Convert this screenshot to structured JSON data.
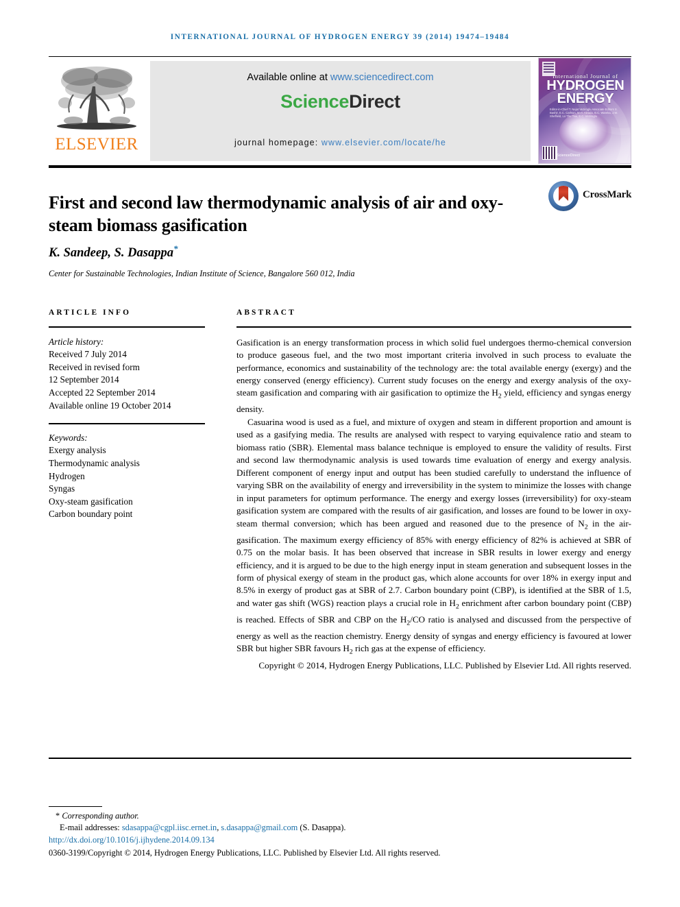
{
  "running_head": "International Journal of Hydrogen Energy 39 (2014) 19474–19484",
  "masthead": {
    "publisher_name": "ELSEVIER",
    "available_prefix": "Available online at ",
    "available_url": "www.sciencedirect.com",
    "sciencedirect_logo_part1": "Science",
    "sciencedirect_logo_part2": "Direct",
    "homepage_label": "journal homepage: ",
    "homepage_url": "www.elsevier.com/locate/he",
    "cover": {
      "line_small": "International Journal of",
      "line_big_1": "HYDROGEN",
      "line_big_2": "ENERGY",
      "editorial_board": "Editor-in-Chief  T. Nejat Veziroglu\nAssociate Editors  S. Bashir, E.C. Carlson, M.H. Aleada, B.C. Wareka, J.W. Sheffield, Lo Thu Tsai, E.C. Veziroglu",
      "footer_label": "ScienceDirect"
    }
  },
  "article": {
    "title": "First and second law thermodynamic analysis of air and oxy-steam biomass gasification",
    "crossmark_label": "CrossMark",
    "authors": "K. Sandeep, S. Dasappa",
    "author_star": "*",
    "affiliation": "Center for Sustainable Technologies, Indian Institute of Science, Bangalore 560 012, India"
  },
  "article_info": {
    "heading": "ARTICLE INFO",
    "history_label": "Article history:",
    "history": [
      "Received 7 July 2014",
      "Received in revised form",
      "12 September 2014",
      "Accepted 22 September 2014",
      "Available online 19 October 2014"
    ],
    "keywords_label": "Keywords:",
    "keywords": [
      "Exergy analysis",
      "Thermodynamic analysis",
      "Hydrogen",
      "Syngas",
      "Oxy-steam gasification",
      "Carbon boundary point"
    ]
  },
  "abstract": {
    "heading": "ABSTRACT",
    "paragraph1": "Gasification is an energy transformation process in which solid fuel undergoes thermo-chemical conversion to produce gaseous fuel, and the two most important criteria involved in such process to evaluate the performance, economics and sustainability of the technology are: the total available energy (exergy) and the energy conserved (energy efficiency). Current study focuses on the energy and exergy analysis of the oxy-steam gasification and comparing with air gasification to optimize the H2 yield, efficiency and syngas energy density.",
    "paragraph2": "Casuarina wood is used as a fuel, and mixture of oxygen and steam in different proportion and amount is used as a gasifying media. The results are analysed with respect to varying equivalence ratio and steam to biomass ratio (SBR). Elemental mass balance technique is employed to ensure the validity of results. First and second law thermodynamic analysis is used towards time evaluation of energy and exergy analysis. Different component of energy input and output has been studied carefully to understand the influence of varying SBR on the availability of energy and irreversibility in the system to minimize the losses with change in input parameters for optimum performance. The energy and exergy losses (irreversibility) for oxy-steam gasification system are compared with the results of air gasification, and losses are found to be lower in oxy-steam thermal conversion; which has been argued and reasoned due to the presence of N2 in the air-gasification. The maximum exergy efficiency of 85% with energy efficiency of 82% is achieved at SBR of 0.75 on the molar basis. It has been observed that increase in SBR results in lower exergy and energy efficiency, and it is argued to be due to the high energy input in steam generation and subsequent losses in the form of physical exergy of steam in the product gas, which alone accounts for over 18% in exergy input and 8.5% in exergy of product gas at SBR of 2.7. Carbon boundary point (CBP), is identified at the SBR of 1.5, and water gas shift (WGS) reaction plays a crucial role in H2 enrichment after carbon boundary point (CBP) is reached. Effects of SBR and CBP on the H2/CO ratio is analysed and discussed from the perspective of energy as well as the reaction chemistry. Energy density of syngas and energy efficiency is favoured at lower SBR but higher SBR favours H2 rich gas at the expense of efficiency.",
    "copyright": "Copyright © 2014, Hydrogen Energy Publications, LLC. Published by Elsevier Ltd. All rights reserved."
  },
  "footnote": {
    "corresponding_star": "*",
    "corresponding_label": "Corresponding author.",
    "email_label": "E-mail addresses: ",
    "email1": "sdasappa@cgpl.iisc.ernet.in",
    "email_sep": ", ",
    "email2": "s.dasappa@gmail.com",
    "email_suffix": " (S. Dasappa).",
    "doi": "http://dx.doi.org/10.1016/j.ijhydene.2014.09.134",
    "issn_line": "0360-3199/Copyright © 2014, Hydrogen Energy Publications, LLC. Published by Elsevier Ltd. All rights reserved."
  },
  "colors": {
    "running_head": "#1a6fa8",
    "elsevier_orange": "#F07F1A",
    "sciencedirect_green": "#3BA845",
    "link_blue": "#3a7dbf",
    "cover_purple": "#7a3b8d"
  }
}
